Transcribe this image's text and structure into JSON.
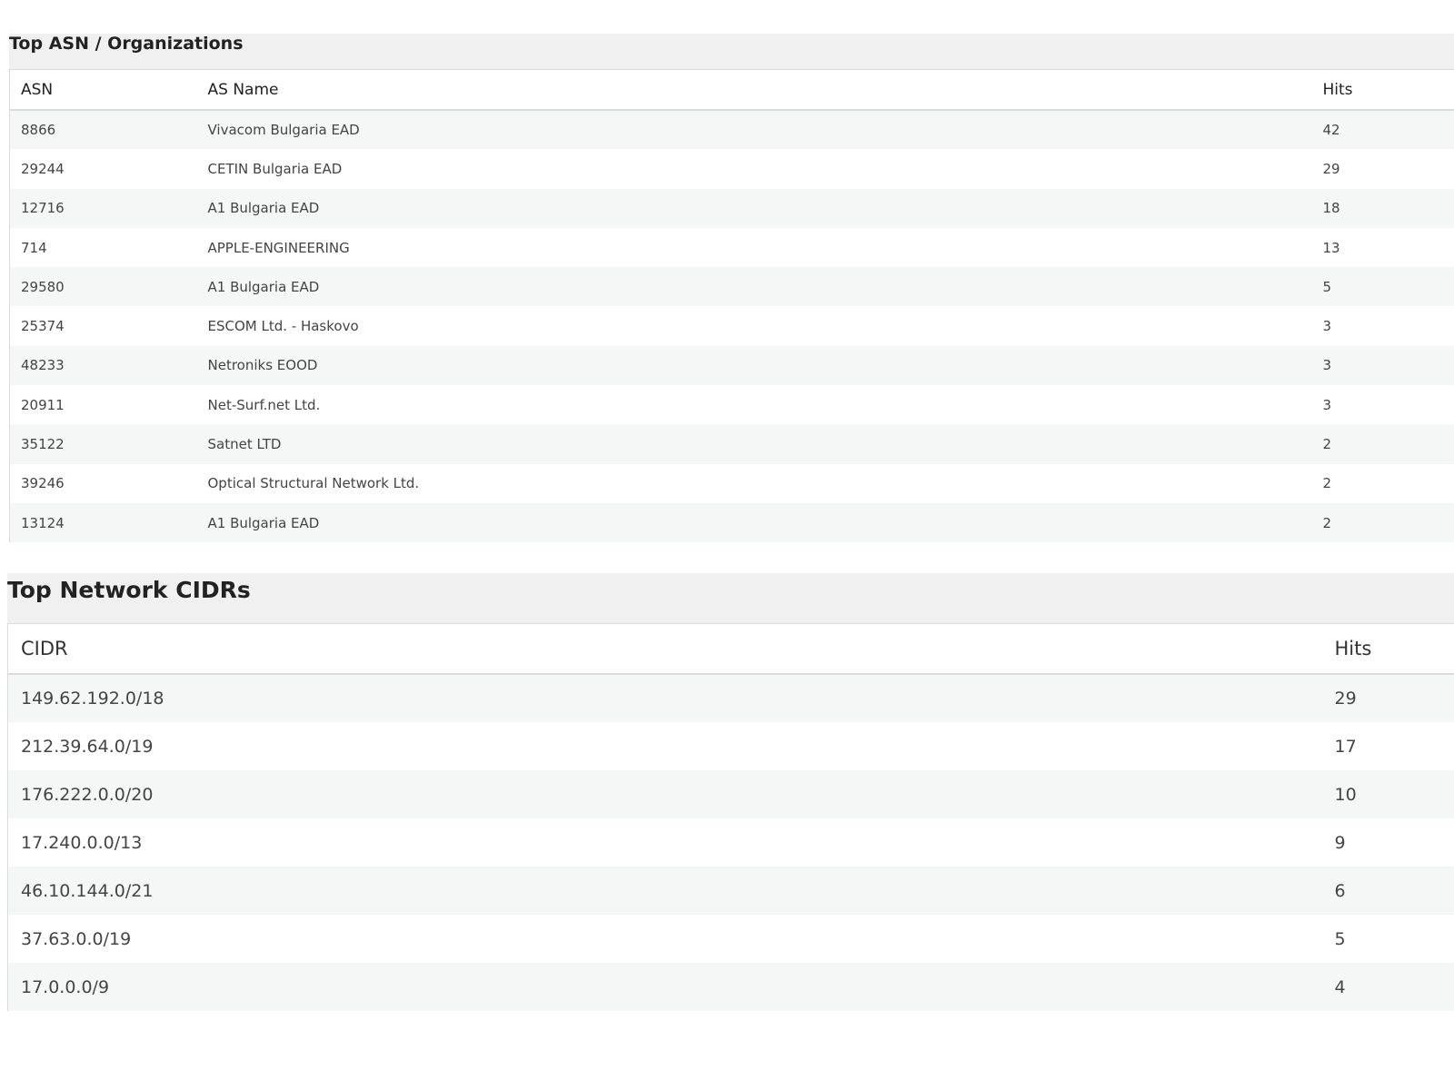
{
  "asn_panel": {
    "title": "Top ASN / Organizations",
    "headers": {
      "asn": "ASN",
      "name": "AS Name",
      "hits": "Hits"
    },
    "rows": [
      {
        "asn": "8866",
        "name": "Vivacom Bulgaria EAD",
        "hits": "42"
      },
      {
        "asn": "29244",
        "name": "CETIN Bulgaria EAD",
        "hits": "29"
      },
      {
        "asn": "12716",
        "name": "A1 Bulgaria EAD",
        "hits": "18"
      },
      {
        "asn": "714",
        "name": "APPLE-ENGINEERING",
        "hits": "13"
      },
      {
        "asn": "29580",
        "name": "A1 Bulgaria EAD",
        "hits": "5"
      },
      {
        "asn": "25374",
        "name": "ESCOM Ltd. - Haskovo",
        "hits": "3"
      },
      {
        "asn": "48233",
        "name": "Netroniks EOOD",
        "hits": "3"
      },
      {
        "asn": "20911",
        "name": "Net-Surf.net Ltd.",
        "hits": "3"
      },
      {
        "asn": "35122",
        "name": "Satnet LTD",
        "hits": "2"
      },
      {
        "asn": "39246",
        "name": "Optical Structural Network Ltd.",
        "hits": "2"
      },
      {
        "asn": "13124",
        "name": "A1 Bulgaria EAD",
        "hits": "2"
      }
    ]
  },
  "cidr_panel": {
    "title": "Top Network CIDRs",
    "headers": {
      "cidr": "CIDR",
      "hits": "Hits"
    },
    "rows": [
      {
        "cidr": "149.62.192.0/18",
        "hits": "29"
      },
      {
        "cidr": "212.39.64.0/19",
        "hits": "17"
      },
      {
        "cidr": "176.222.0.0/20",
        "hits": "10"
      },
      {
        "cidr": "17.240.0.0/13",
        "hits": "9"
      },
      {
        "cidr": "46.10.144.0/21",
        "hits": "6"
      },
      {
        "cidr": "37.63.0.0/19",
        "hits": "5"
      },
      {
        "cidr": "17.0.0.0/9",
        "hits": "4"
      }
    ]
  }
}
